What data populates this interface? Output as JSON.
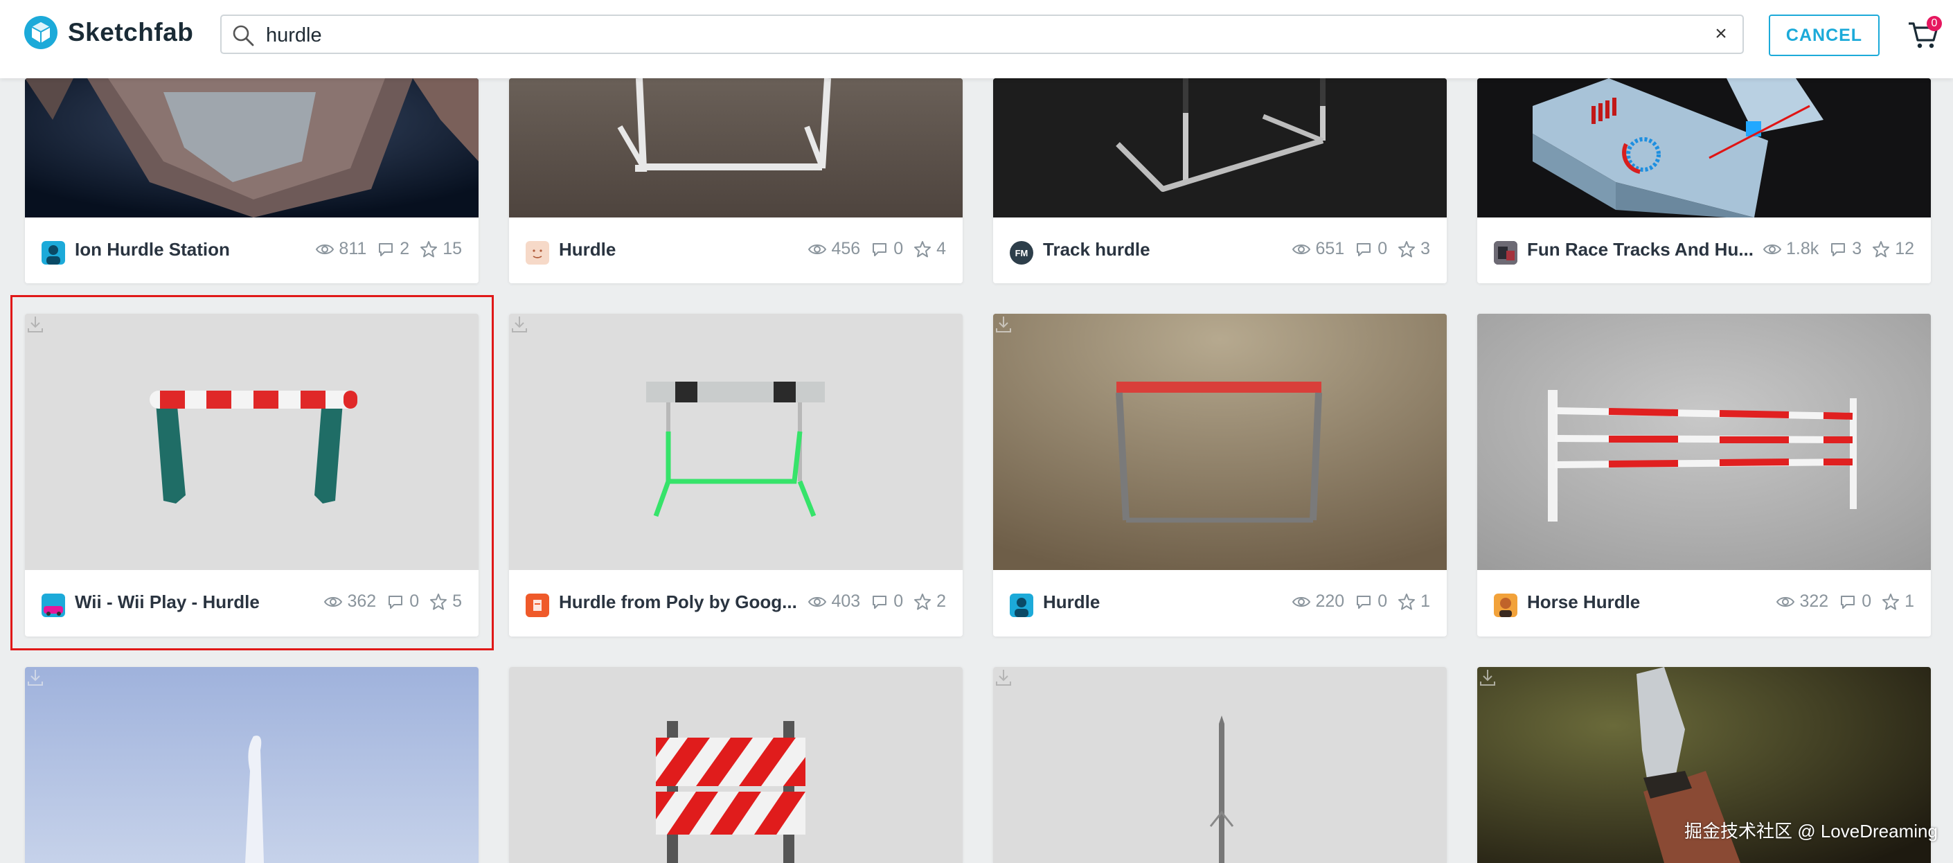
{
  "header": {
    "brand": "Sketchfab",
    "search": {
      "value": "hurdle",
      "placeholder": ""
    },
    "cancel_label": "CANCEL",
    "cart_badge": "0"
  },
  "colors": {
    "accent": "#1caad9",
    "badge": "#e6175f",
    "highlight": "#e01818"
  },
  "results": [
    {
      "title": "Ion Hurdle Station",
      "views": "811",
      "comments": "2",
      "likes": "15",
      "avatar": "avatar-blue-person"
    },
    {
      "title": "Hurdle",
      "views": "456",
      "comments": "0",
      "likes": "4",
      "avatar": "avatar-cartoon-face"
    },
    {
      "title": "Track hurdle",
      "views": "651",
      "comments": "0",
      "likes": "3",
      "avatar": "avatar-fm-logo"
    },
    {
      "title": "Fun Race Tracks And Hu...",
      "views": "1.8k",
      "comments": "3",
      "likes": "12",
      "avatar": "avatar-photo"
    },
    {
      "title": "Wii - Wii Play - Hurdle",
      "views": "362",
      "comments": "0",
      "likes": "5",
      "avatar": "avatar-pink-car"
    },
    {
      "title": "Hurdle from Poly by Goog...",
      "views": "403",
      "comments": "0",
      "likes": "2",
      "avatar": "avatar-orange-poly"
    },
    {
      "title": "Hurdle",
      "views": "220",
      "comments": "0",
      "likes": "1",
      "avatar": "avatar-blue-person"
    },
    {
      "title": "Horse Hurdle",
      "views": "322",
      "comments": "0",
      "likes": "1",
      "avatar": "avatar-person-orange"
    }
  ],
  "watermark": "掘金技术社区 @ LoveDreaming"
}
